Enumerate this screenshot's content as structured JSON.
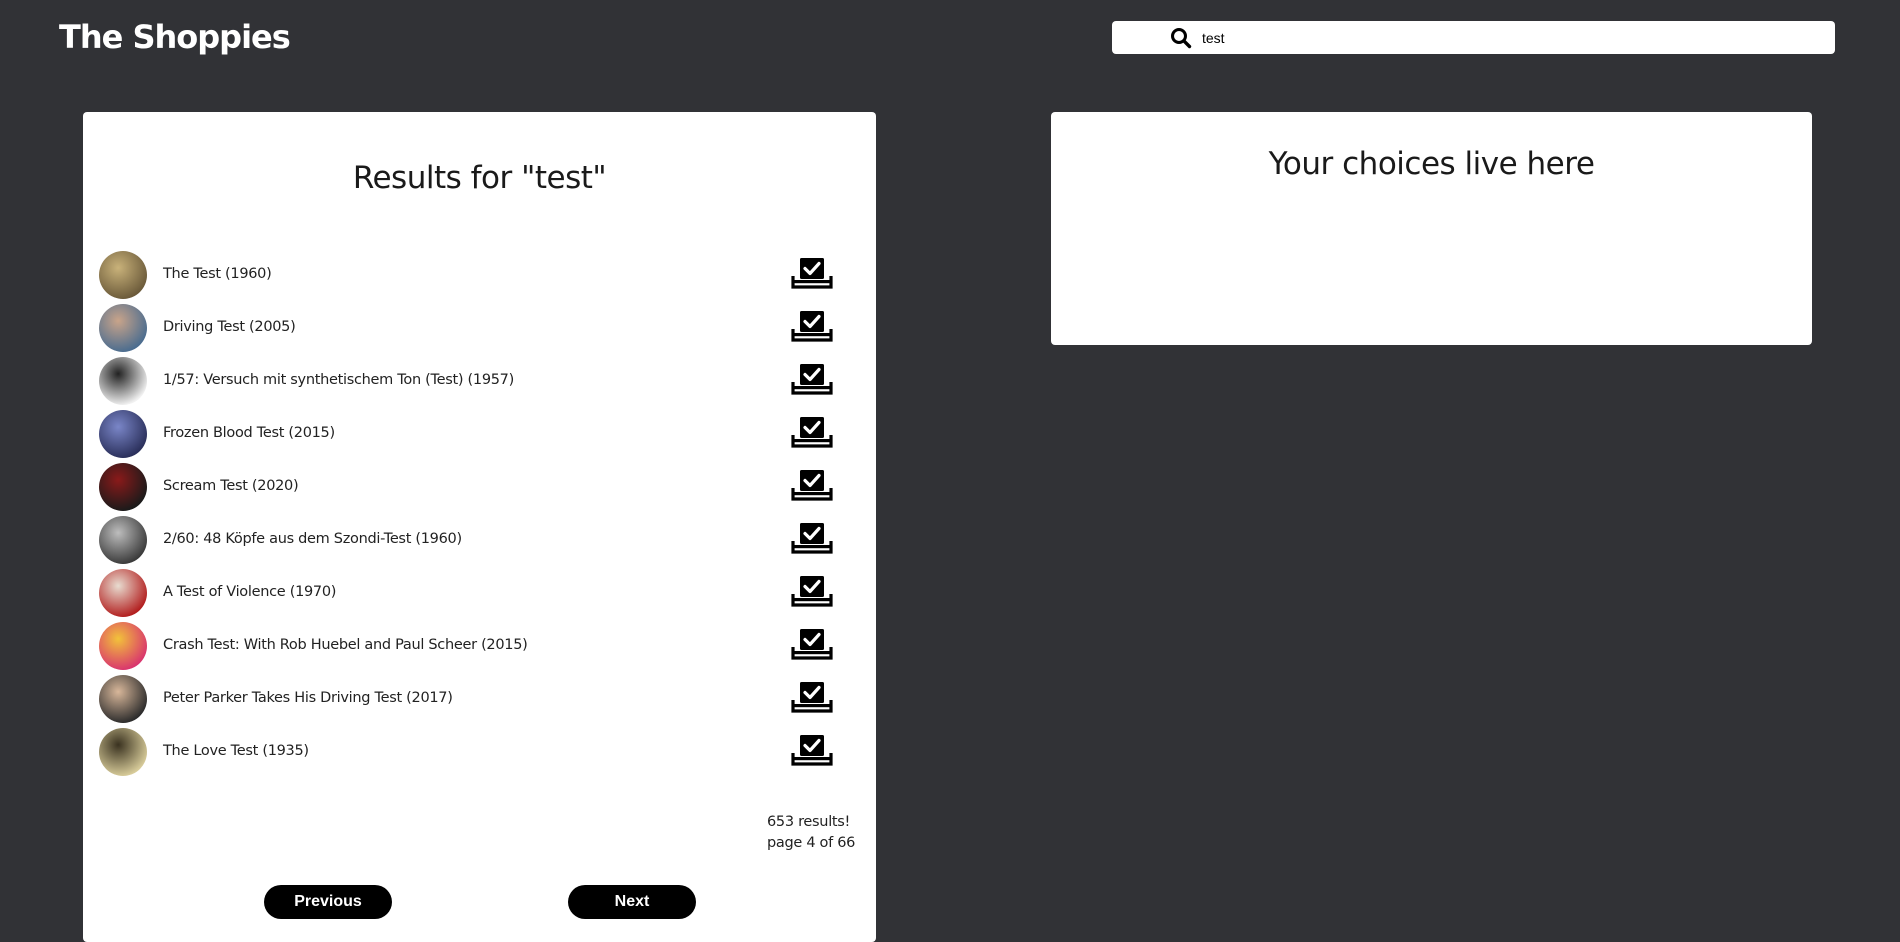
{
  "header": {
    "app_title": "The Shoppies",
    "search": {
      "value": "test",
      "placeholder": ""
    }
  },
  "results_panel": {
    "heading": "Results for \"test\"",
    "items": [
      {
        "title": "The Test (1960)",
        "thumb_colors": [
          "#6b5a3a",
          "#c9b27a"
        ]
      },
      {
        "title": "Driving Test (2005)",
        "thumb_colors": [
          "#4a6c8f",
          "#c9a48a"
        ]
      },
      {
        "title": "1/57: Versuch mit synthetischem Ton (Test) (1957)",
        "thumb_colors": [
          "#f2f2f2",
          "#222222"
        ]
      },
      {
        "title": "Frozen  Blood Test (2015)",
        "thumb_colors": [
          "#2a2f5a",
          "#7a86c8"
        ]
      },
      {
        "title": "Scream Test (2020)",
        "thumb_colors": [
          "#1a1a1a",
          "#8a1a1a"
        ]
      },
      {
        "title": "2/60: 48  Köpfe aus dem Szondi-Test (1960)",
        "thumb_colors": [
          "#3a3a3a",
          "#bdbdbd"
        ]
      },
      {
        "title": "A Test of Violence (1970)",
        "thumb_colors": [
          "#b21e1e",
          "#e8dcd0"
        ]
      },
      {
        "title": "Crash Test: With  Rob  Huebel and  Paul Scheer (2015)",
        "thumb_colors": [
          "#d9356e",
          "#f2c23a"
        ]
      },
      {
        "title": "Peter  Parker Takes  His  Driving Test (2017)",
        "thumb_colors": [
          "#2b2b2b",
          "#d8b79a"
        ]
      },
      {
        "title": "The  Love Test (1935)",
        "thumb_colors": [
          "#d8cc9a",
          "#3a3220"
        ]
      }
    ],
    "result_count": "653 results!",
    "page_info": "page  4 of  66",
    "previous_label": "Previous",
    "next_label": "Next"
  },
  "choices_panel": {
    "heading": "Your choices live here"
  },
  "icons": {
    "search": "search-icon",
    "nominate": "ballot-box-check-icon"
  }
}
